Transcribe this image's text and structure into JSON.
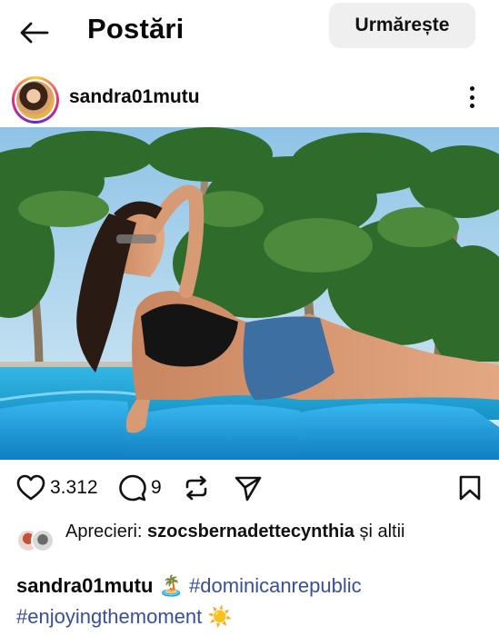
{
  "header": {
    "title": "Postări",
    "follow_label": "Urmărește"
  },
  "post": {
    "username": "sandra01mutu",
    "likes_count": "3.312",
    "comments_count": "9",
    "likes_prefix": "Aprecieri:",
    "liked_by": "szocsbernadettecynthia",
    "likes_suffix": "și altii",
    "caption_user": "sandra01mutu",
    "caption_emoji_1": "🏝️",
    "hashtag_1": "#dominicanrepublic",
    "hashtag_2": "#enjoyingthemoment",
    "caption_emoji_2": "☀️"
  },
  "icons": {
    "back": "arrow-left-icon",
    "more": "more-vertical-icon",
    "like": "heart-icon",
    "comment": "comment-icon",
    "repost": "repost-icon",
    "share": "send-icon",
    "save": "bookmark-icon"
  },
  "colors": {
    "follow_bg": "#efefef",
    "hashtag": "#3a4f9a",
    "pool": "#1aa9e0",
    "cushion": "#1b9ee0"
  }
}
